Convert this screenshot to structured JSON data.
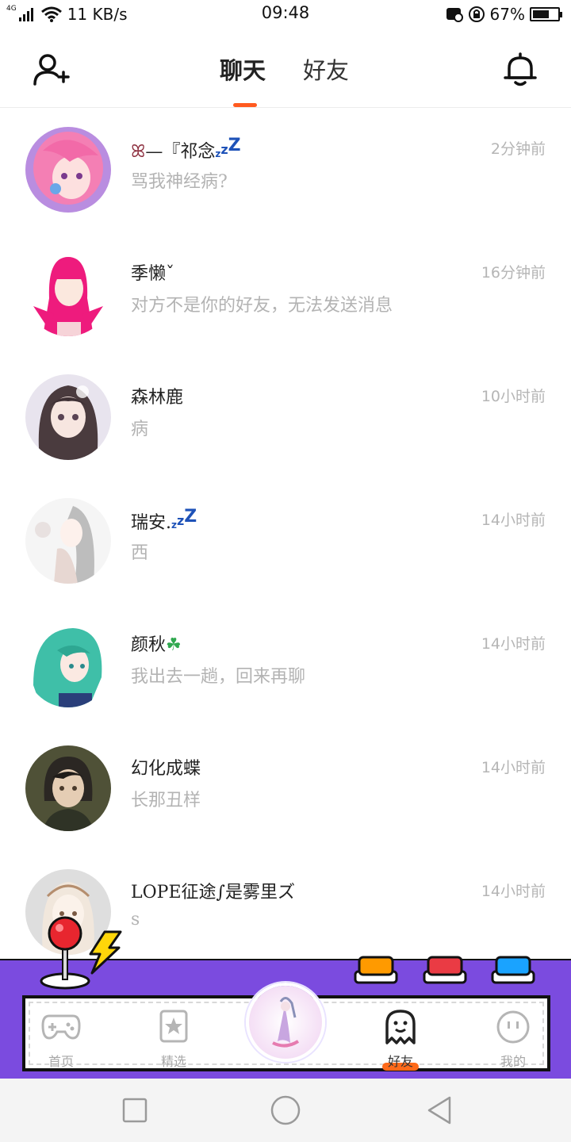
{
  "status_bar": {
    "network_type": "4G",
    "speed": "11 KB/s",
    "time": "09:48",
    "battery_text": "67%",
    "battery_level": 0.67
  },
  "header": {
    "tabs": [
      {
        "label": "聊天",
        "active": true
      },
      {
        "label": "好友",
        "active": false
      }
    ],
    "left_icon": "add-user-icon",
    "right_icon": "bell-icon",
    "accent_color": "#ff5a1f"
  },
  "chats": [
    {
      "name": "—『祁念",
      "name_suffix": "zzZ",
      "message": "骂我神经病?",
      "time": "2分钟前"
    },
    {
      "name": "季懒ˇ",
      "name_suffix": "",
      "message": "对方不是你的好友，无法发送消息",
      "time": "16分钟前"
    },
    {
      "name": "森林鹿",
      "name_suffix": "",
      "message": "病",
      "time": "10小时前"
    },
    {
      "name": "瑞安.",
      "name_suffix": "zzZ",
      "message": "西",
      "time": "14小时前"
    },
    {
      "name": "颜秋",
      "name_suffix": "",
      "message": "我出去一趟，回来再聊",
      "time": "14小时前"
    },
    {
      "name": "幻化成蝶",
      "name_suffix": "",
      "message": "长那丑样",
      "time": "14小时前"
    },
    {
      "name": "LOPE征途∫是雾里ズ",
      "name_suffix": "",
      "message": "s",
      "time": "14小时前"
    }
  ],
  "bottom_nav": {
    "items": [
      {
        "label": "首页",
        "icon": "gamepad-icon",
        "active": false
      },
      {
        "label": "精选",
        "icon": "star-badge-icon",
        "active": false
      },
      {
        "label": "好友",
        "icon": "ghost-icon",
        "active": true
      },
      {
        "label": "我的",
        "icon": "smiley-icon",
        "active": false
      }
    ],
    "bar_color": "#7b4bdf",
    "arcade_buttons": [
      "orange",
      "red",
      "blue"
    ]
  },
  "system_nav": {
    "buttons": [
      "recents-icon",
      "home-icon",
      "back-icon"
    ]
  }
}
